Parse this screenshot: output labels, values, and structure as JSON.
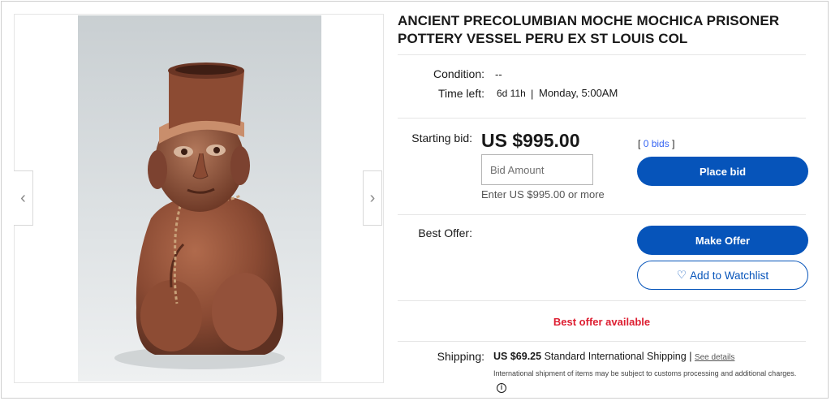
{
  "listing": {
    "title": "ANCIENT PRECOLUMBIAN MOCHE MOCHICA PRISONER POTTERY VESSEL PERU EX ST LOUIS COL",
    "photo_alt": "Moche pottery vessel photo"
  },
  "gallery": {
    "prev_icon": "‹",
    "next_icon": "›"
  },
  "details": {
    "condition_label": "Condition:",
    "condition_value": "--",
    "time_left_label": "Time left:",
    "time_left_value": "6d 11h",
    "time_separator": "|",
    "end_time": "Monday, 5:00AM"
  },
  "bidding": {
    "starting_bid_label": "Starting bid:",
    "price": "US $995.00",
    "bid_placeholder": "Bid Amount",
    "hint": "Enter US $995.00 or more",
    "bids_open": "[",
    "bids_link": "0 bids",
    "bids_close": "]",
    "place_bid_label": "Place bid"
  },
  "offer": {
    "best_offer_label": "Best Offer:",
    "make_offer_label": "Make Offer",
    "watchlist_icon": "♡",
    "watchlist_label": "Add to Watchlist",
    "banner": "Best offer available"
  },
  "shipping": {
    "label": "Shipping:",
    "cost": "US $69.25",
    "method": "Standard International Shipping",
    "separator": "|",
    "see_details": "See details",
    "note": "International shipment of items may be subject to customs processing and additional charges.",
    "info_icon": "i"
  },
  "colors": {
    "primary_button": "#0654ba",
    "link": "#3665f3",
    "alert": "#dd1e31"
  }
}
